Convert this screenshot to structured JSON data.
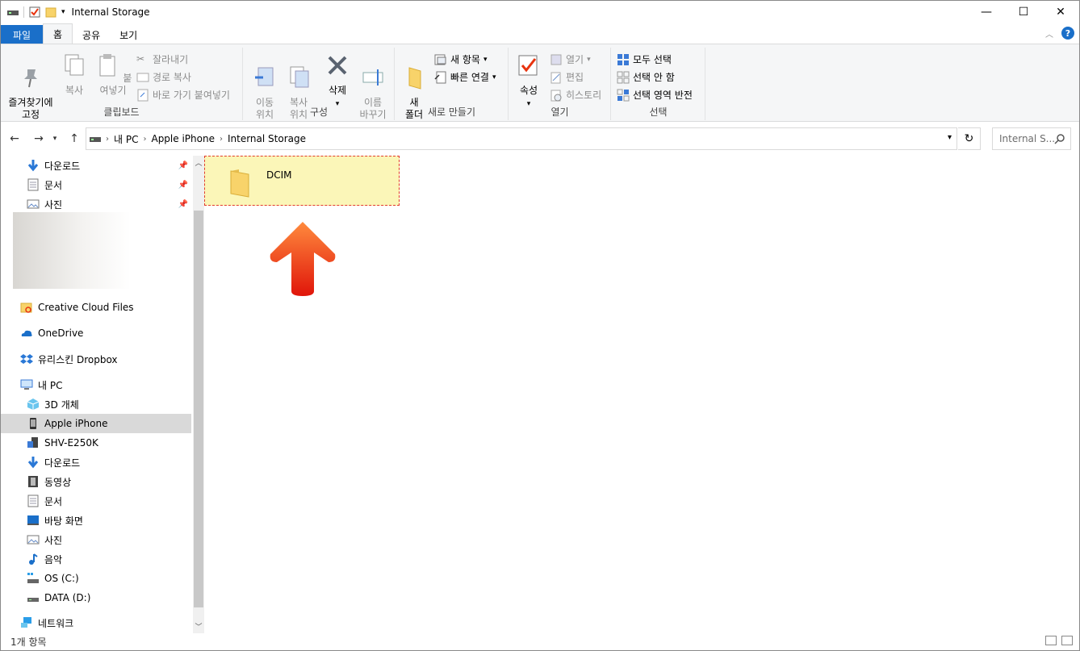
{
  "window": {
    "title": "Internal Storage",
    "min": "—",
    "max": "☐",
    "close": "✕"
  },
  "tabs": {
    "file": "파일",
    "home": "홈",
    "share": "공유",
    "view": "보기"
  },
  "ribbon": {
    "clipboard": {
      "label": "클립보드",
      "pin": "즐겨찾기에\n고정",
      "copy": "복사",
      "paste": "붙여넣기",
      "cut": "잘라내기",
      "copy_path": "경로 복사",
      "paste_shortcut": "바로 가기 붙여넣기"
    },
    "organize": {
      "label": "구성",
      "move_to": "이동\n위치",
      "copy_to": "복사\n위치",
      "delete": "삭제",
      "rename": "이름\n바꾸기"
    },
    "new": {
      "label": "새로 만들기",
      "new_folder": "새\n폴더",
      "new_item": "새 항목",
      "easy_access": "빠른 연결"
    },
    "open": {
      "label": "열기",
      "properties": "속성",
      "open": "열기",
      "edit": "편집",
      "history": "히스토리"
    },
    "select": {
      "label": "선택",
      "select_all": "모두 선택",
      "select_none": "선택 안 함",
      "invert": "선택 영역 반전"
    }
  },
  "address": {
    "path": [
      "내 PC",
      "Apple iPhone",
      "Internal Storage"
    ],
    "search_placeholder": "Internal S..."
  },
  "nav": {
    "quick": [
      "다운로드",
      "문서",
      "사진"
    ],
    "creative_cloud": "Creative Cloud Files",
    "onedrive": "OneDrive",
    "dropbox": "유리스킨 Dropbox",
    "this_pc": "내 PC",
    "pc_items": [
      "3D 개체",
      "Apple iPhone",
      "SHV-E250K",
      "다운로드",
      "동영상",
      "문서",
      "바탕 화면",
      "사진",
      "음악",
      "OS (C:)",
      "DATA (D:)"
    ],
    "network": "네트워크"
  },
  "content": {
    "items": [
      {
        "name": "DCIM"
      }
    ]
  },
  "status": {
    "count": "1개 항목"
  },
  "colors": {
    "accent": "#1a6fc9",
    "selected_bg": "#fbf6b8",
    "arrow": "#e8330f"
  }
}
